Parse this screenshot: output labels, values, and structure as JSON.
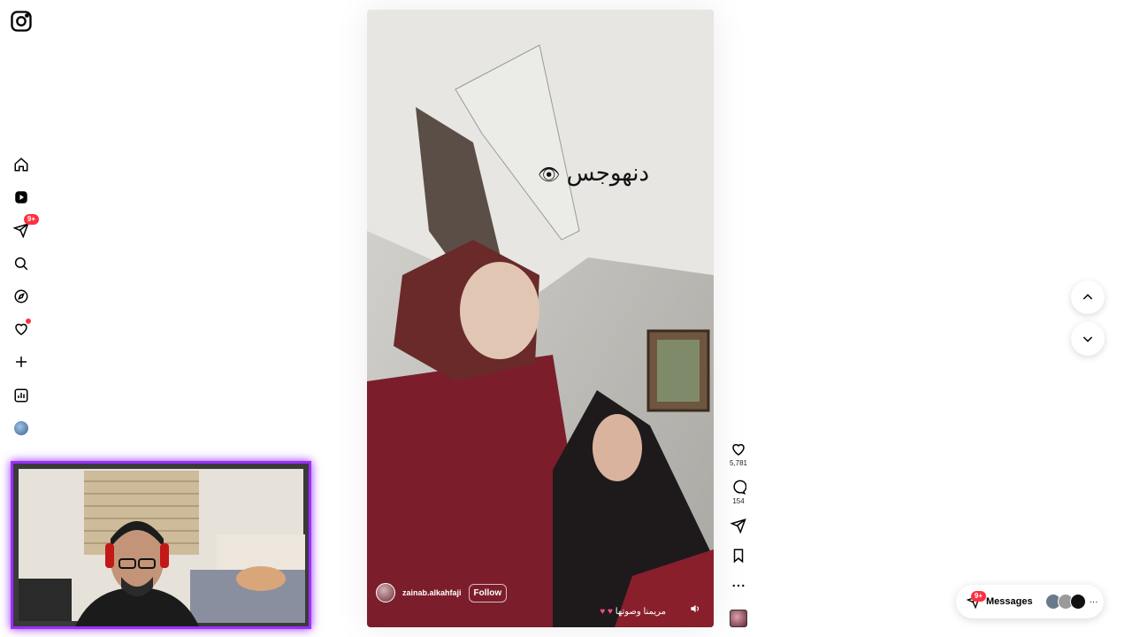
{
  "sidebar": {
    "logo_icon": "instagram-icon",
    "items": [
      {
        "name": "home",
        "icon": "home-icon"
      },
      {
        "name": "reels",
        "icon": "reels-icon"
      },
      {
        "name": "messages",
        "icon": "send-icon",
        "badge": "9+"
      },
      {
        "name": "search",
        "icon": "search-icon"
      },
      {
        "name": "explore",
        "icon": "compass-icon"
      },
      {
        "name": "notifications",
        "icon": "heart-icon"
      },
      {
        "name": "create",
        "icon": "plus-icon"
      },
      {
        "name": "dashboard",
        "icon": "chart-icon"
      },
      {
        "name": "profile",
        "icon": "avatar"
      }
    ]
  },
  "reel": {
    "overlay_text": "دنهوجس",
    "author": "zainab.alkahfaji",
    "follow_label": "Follow",
    "caption": "مريمنا وصوتها"
  },
  "actions": {
    "likes": "5,781",
    "comments": "154"
  },
  "messages_bar": {
    "label": "Messages",
    "badge": "9+"
  },
  "colors": {
    "accent": "#ff3040",
    "webcam_border": "#9b30ff"
  }
}
